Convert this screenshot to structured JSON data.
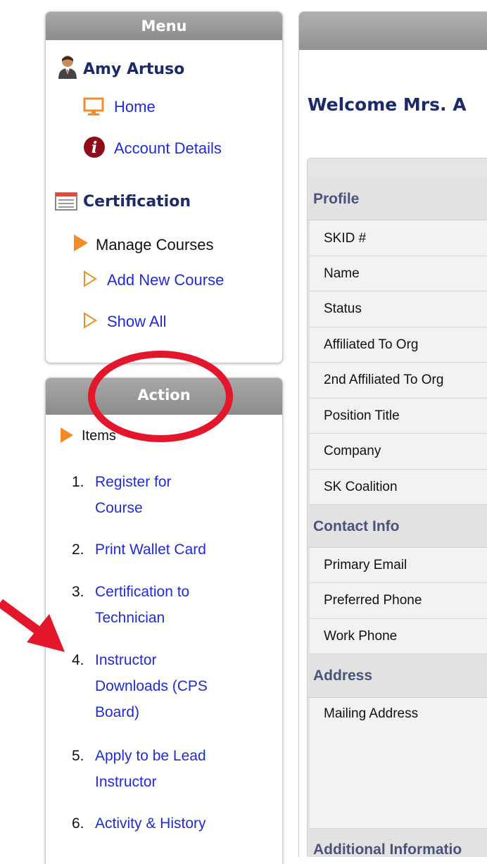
{
  "menu": {
    "title": "Menu",
    "user_name": "Amy Artuso",
    "home_label": "Home",
    "account_label": "Account Details",
    "certification_label": "Certification",
    "manage_courses_label": "Manage Courses",
    "add_course_label": "Add New Course",
    "show_all_label": "Show All"
  },
  "action": {
    "title": "Action",
    "items_label": "Items",
    "items": [
      {
        "num": "1.",
        "label": "Register for Course"
      },
      {
        "num": "2.",
        "label": "Print Wallet Card"
      },
      {
        "num": "3.",
        "label": "Certification to Technician"
      },
      {
        "num": "4.",
        "label": "Instructor Downloads (CPS Board)"
      },
      {
        "num": "5.",
        "label": "Apply to be Lead Instructor"
      },
      {
        "num": "6.",
        "label": "Activity & History"
      }
    ]
  },
  "main": {
    "welcome": "Welcome Mrs. A",
    "groups": {
      "profile": "Profile",
      "contact": "Contact Info",
      "address": "Address",
      "additional": "Additional Informatio"
    },
    "profile_rows": [
      "SKID #",
      "Name",
      "Status",
      "Affiliated To Org",
      "2nd Affiliated To Org",
      "Position Title",
      "Company",
      "SK Coalition"
    ],
    "contact_rows": [
      "Primary Email",
      "Preferred Phone",
      "Work Phone"
    ],
    "address_rows": [
      "Mailing Address"
    ]
  },
  "colors": {
    "link": "#1f2bd6",
    "heading": "#1c2a6b",
    "accent_orange": "#f28c28",
    "annotation_red": "#e3162b"
  }
}
